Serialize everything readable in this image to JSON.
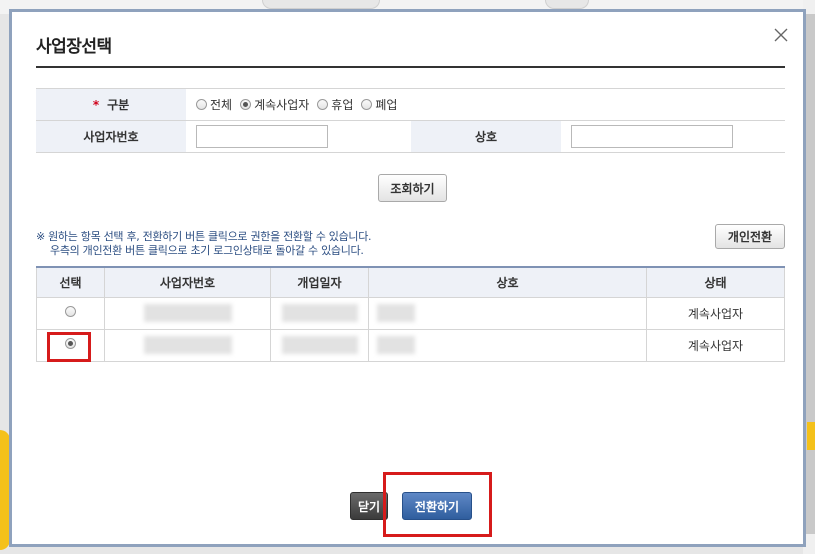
{
  "modal": {
    "title": "사업장선택"
  },
  "search": {
    "category_label": "구분",
    "required_mark": "*",
    "radio_options": [
      "전체",
      "계속사업자",
      "휴업",
      "폐업"
    ],
    "selected_option": "계속사업자",
    "business_number_label": "사업자번호",
    "business_number_value": "",
    "company_name_label": "상호",
    "company_name_value": "",
    "search_button": "조회하기"
  },
  "notice": {
    "line1": "※ 원하는 항목 선택 후, 전환하기 버튼 클릭으로 권한을 전환할 수 있습니다.",
    "line2": "우측의 개인전환 버튼 클릭으로 초기 로그인상태로 돌아갈 수 있습니다."
  },
  "personal_switch_button": "개인전환",
  "table": {
    "headers": [
      "선택",
      "사업자번호",
      "개업일자",
      "상호",
      "상태"
    ],
    "rows": [
      {
        "selected": false,
        "status": "계속사업자"
      },
      {
        "selected": true,
        "status": "계속사업자"
      }
    ]
  },
  "footer": {
    "close_button": "닫기",
    "switch_button": "전환하기"
  },
  "colors": {
    "accent": "#2f5e9e",
    "highlight": "#d61b1b",
    "notice_text": "#2c4e82",
    "header_bg": "#eef1f7"
  }
}
